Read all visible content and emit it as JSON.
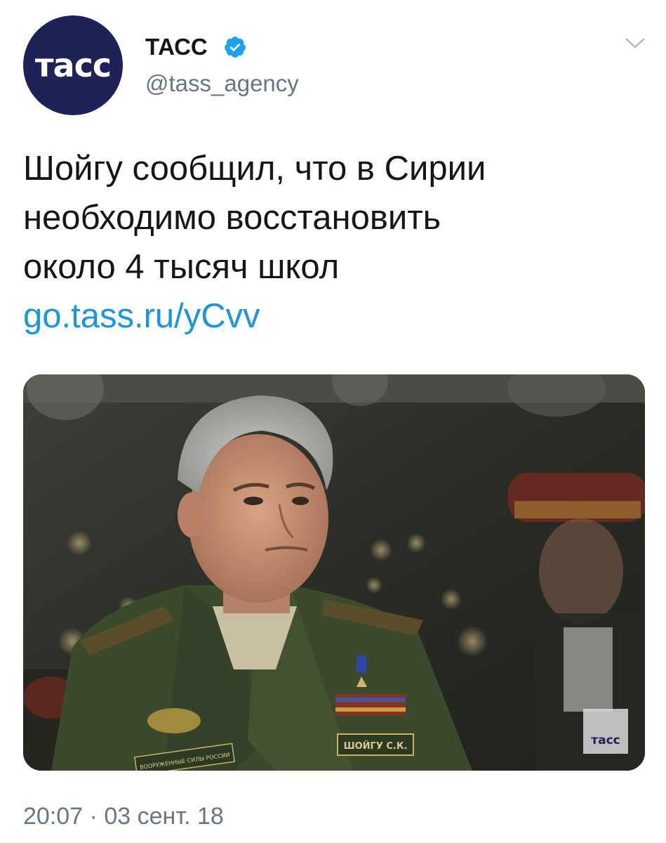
{
  "account": {
    "display_name": "ТАСС",
    "handle": "@tass_agency",
    "avatar_text": "тасс",
    "avatar_color": "#1e2257",
    "verified_icon": "verified-badge-icon"
  },
  "tweet": {
    "text_lines": [
      "Шойгу сообщил, что в Сирии",
      "необходимо восстановить",
      "около 4 тысяч школ"
    ],
    "link": "go.tass.ru/yCvv"
  },
  "media": {
    "watermark": "тасс",
    "badge_text": "ШОЙГУ С.К.",
    "patch_text": "ВООРУЖЕННЫЕ СИЛЫ РОССИИ"
  },
  "meta": {
    "time": "20:07",
    "separator": "·",
    "date": "03 сент. 18"
  },
  "colors": {
    "link": "#1b95e0",
    "secondary_text": "#657786",
    "verified": "#1da1f2"
  }
}
